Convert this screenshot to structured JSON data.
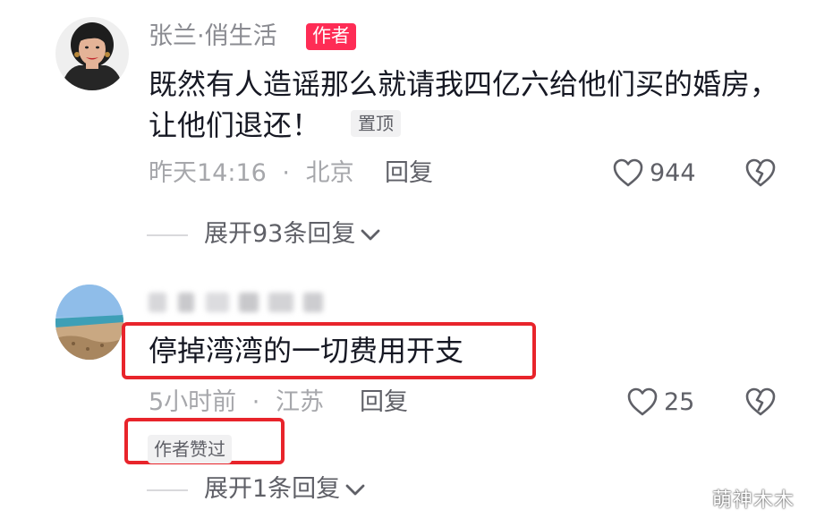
{
  "comments": [
    {
      "user_name": "张兰·俏生活",
      "author_badge": "作者",
      "content": "既然有人造谣那么就请我四亿六给他们买的婚房，让他们退还！",
      "pinned_label": "置顶",
      "time": "昨天14:16",
      "location": "北京",
      "separator": "·",
      "reply_label": "回复",
      "likes": "944",
      "expand_label": "展开93条回复",
      "avatar_icon": "woman-portrait"
    },
    {
      "user_name": "",
      "content": "停掉湾湾的一切费用开支",
      "time": "5小时前",
      "location": "江苏",
      "separator": "·",
      "reply_label": "回复",
      "likes": "25",
      "author_liked_label": "作者赞过",
      "expand_label": "展开1条回复",
      "avatar_icon": "beach-landscape"
    }
  ],
  "watermark": "萌神木木",
  "colors": {
    "author_badge": "#fe2c55",
    "highlight_box": "#e8242b",
    "primary_text": "#161823",
    "secondary_text": "#a6a7ab"
  }
}
